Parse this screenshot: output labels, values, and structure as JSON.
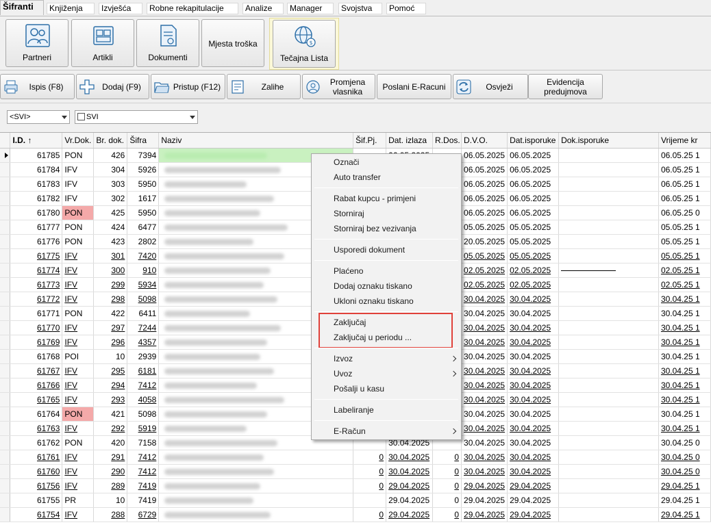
{
  "tabs": [
    {
      "label": "Šifranti",
      "active": true
    },
    {
      "label": "Knjiženja"
    },
    {
      "label": "Izvješća"
    },
    {
      "label": "Robne rekapitulacije"
    },
    {
      "label": "Analize"
    },
    {
      "label": "Manager"
    },
    {
      "label": "Svojstva"
    },
    {
      "label": "Pomoć"
    }
  ],
  "ribbon": {
    "buttons": [
      {
        "label": "Partneri",
        "icon": "partners-icon"
      },
      {
        "label": "Artikli",
        "icon": "articles-icon"
      },
      {
        "label": "Dokumenti",
        "icon": "documents-icon"
      },
      {
        "label": "Mjesta troška"
      },
      {
        "label": "Tečajna Lista",
        "icon": "exchange-rate-icon"
      }
    ]
  },
  "toolbar": {
    "buttons": [
      {
        "label": "Ispis (F8)",
        "icon": "print-icon"
      },
      {
        "label": "Dodaj (F9)",
        "icon": "add-icon"
      },
      {
        "label": "Pristup (F12)",
        "icon": "folder-icon"
      },
      {
        "label": "Zalihe",
        "icon": "stock-icon"
      },
      {
        "label": "Promjena vlasnika",
        "icon": "owner-change-icon"
      },
      {
        "label": "Poslani E-Racuni"
      },
      {
        "label": "Osvježi",
        "icon": "refresh-icon"
      },
      {
        "label": "Evidencija predujmova"
      }
    ]
  },
  "filters": {
    "filter1": "<SVI>",
    "filter2": "SVI"
  },
  "grid": {
    "columns": [
      "I.D. ↑",
      "Vr.Dok.",
      "Br. dok.",
      "Šifra",
      "Naziv",
      "Šif.Pj.",
      "Dat. izlaza",
      "R.Dos.",
      "D.V.O.",
      "Dat.isporuke",
      "Dok.isporuke",
      "Vrijeme kr"
    ],
    "rows": [
      {
        "id": "61785",
        "vr": "PON",
        "br": "426",
        "sifra": "7394",
        "sifpj": "",
        "datiz": "06.05.2025",
        "rdos": "",
        "dvo": "06.05.2025",
        "datisp": "06.05.2025",
        "vrijeme": "06.05.25 1",
        "u": false,
        "current": true,
        "green": true
      },
      {
        "id": "61784",
        "vr": "IFV",
        "br": "304",
        "sifra": "5926",
        "sifpj": "",
        "datiz": "",
        "rdos": "",
        "dvo": "06.05.2025",
        "datisp": "06.05.2025",
        "vrijeme": "06.05.25 1",
        "u": false
      },
      {
        "id": "61783",
        "vr": "IFV",
        "br": "303",
        "sifra": "5950",
        "sifpj": "",
        "datiz": "",
        "rdos": "",
        "dvo": "06.05.2025",
        "datisp": "06.05.2025",
        "vrijeme": "06.05.25 1",
        "u": false
      },
      {
        "id": "61782",
        "vr": "IFV",
        "br": "302",
        "sifra": "1617",
        "sifpj": "",
        "datiz": "",
        "rdos": "",
        "dvo": "06.05.2025",
        "datisp": "06.05.2025",
        "vrijeme": "06.05.25 1",
        "u": false
      },
      {
        "id": "61780",
        "vr": "PON",
        "br": "425",
        "sifra": "5950",
        "sifpj": "",
        "datiz": "",
        "rdos": "",
        "dvo": "06.05.2025",
        "datisp": "06.05.2025",
        "vrijeme": "06.05.25 0",
        "u": false,
        "red": true
      },
      {
        "id": "61777",
        "vr": "PON",
        "br": "424",
        "sifra": "6477",
        "sifpj": "",
        "datiz": "",
        "rdos": "",
        "dvo": "05.05.2025",
        "datisp": "05.05.2025",
        "vrijeme": "05.05.25 1",
        "u": false
      },
      {
        "id": "61776",
        "vr": "PON",
        "br": "423",
        "sifra": "2802",
        "sifpj": "",
        "datiz": "",
        "rdos": "",
        "dvo": "20.05.2025",
        "datisp": "05.05.2025",
        "vrijeme": "05.05.25 1",
        "u": false
      },
      {
        "id": "61775",
        "vr": "IFV",
        "br": "301",
        "sifra": "7420",
        "sifpj": "",
        "datiz": "",
        "rdos": "",
        "dvo": "05.05.2025",
        "datisp": "05.05.2025",
        "vrijeme": "05.05.25 1",
        "u": true
      },
      {
        "id": "61774",
        "vr": "IFV",
        "br": "300",
        "sifra": "910",
        "sifpj": "",
        "datiz": "",
        "rdos": "",
        "dvo": "02.05.2025",
        "datisp": "02.05.2025",
        "vrijeme": "02.05.25 1",
        "u": true,
        "dokline": true
      },
      {
        "id": "61773",
        "vr": "IFV",
        "br": "299",
        "sifra": "5934",
        "sifpj": "",
        "datiz": "",
        "rdos": "",
        "dvo": "02.05.2025",
        "datisp": "02.05.2025",
        "vrijeme": "02.05.25 1",
        "u": true
      },
      {
        "id": "61772",
        "vr": "IFV",
        "br": "298",
        "sifra": "5098",
        "sifpj": "",
        "datiz": "",
        "rdos": "",
        "dvo": "30.04.2025",
        "datisp": "30.04.2025",
        "vrijeme": "30.04.25 1",
        "u": true
      },
      {
        "id": "61771",
        "vr": "PON",
        "br": "422",
        "sifra": "6411",
        "sifpj": "",
        "datiz": "",
        "rdos": "",
        "dvo": "30.04.2025",
        "datisp": "30.04.2025",
        "vrijeme": "30.04.25 1",
        "u": false
      },
      {
        "id": "61770",
        "vr": "IFV",
        "br": "297",
        "sifra": "7244",
        "sifpj": "",
        "datiz": "",
        "rdos": "",
        "dvo": "30.04.2025",
        "datisp": "30.04.2025",
        "vrijeme": "30.04.25 1",
        "u": true
      },
      {
        "id": "61769",
        "vr": "IFV",
        "br": "296",
        "sifra": "4357",
        "sifpj": "",
        "datiz": "",
        "rdos": "",
        "dvo": "30.04.2025",
        "datisp": "30.04.2025",
        "vrijeme": "30.04.25 1",
        "u": true
      },
      {
        "id": "61768",
        "vr": "POI",
        "br": "10",
        "sifra": "2939",
        "sifpj": "",
        "datiz": "",
        "rdos": "",
        "dvo": "30.04.2025",
        "datisp": "30.04.2025",
        "vrijeme": "30.04.25 1",
        "u": false
      },
      {
        "id": "61767",
        "vr": "IFV",
        "br": "295",
        "sifra": "6181",
        "sifpj": "",
        "datiz": "",
        "rdos": "",
        "dvo": "30.04.2025",
        "datisp": "30.04.2025",
        "vrijeme": "30.04.25 1",
        "u": true
      },
      {
        "id": "61766",
        "vr": "IFV",
        "br": "294",
        "sifra": "7412",
        "sifpj": "",
        "datiz": "",
        "rdos": "",
        "dvo": "30.04.2025",
        "datisp": "30.04.2025",
        "vrijeme": "30.04.25 1",
        "u": true
      },
      {
        "id": "61765",
        "vr": "IFV",
        "br": "293",
        "sifra": "4058",
        "sifpj": "",
        "datiz": "",
        "rdos": "",
        "dvo": "30.04.2025",
        "datisp": "30.04.2025",
        "vrijeme": "30.04.25 1",
        "u": true
      },
      {
        "id": "61764",
        "vr": "PON",
        "br": "421",
        "sifra": "5098",
        "sifpj": "",
        "datiz": "",
        "rdos": "",
        "dvo": "30.04.2025",
        "datisp": "30.04.2025",
        "vrijeme": "30.04.25 1",
        "u": false,
        "red": true
      },
      {
        "id": "61763",
        "vr": "IFV",
        "br": "292",
        "sifra": "5919",
        "sifpj": "",
        "datiz": "",
        "rdos": "",
        "dvo": "30.04.2025",
        "datisp": "30.04.2025",
        "vrijeme": "30.04.25 1",
        "u": true
      },
      {
        "id": "61762",
        "vr": "PON",
        "br": "420",
        "sifra": "7158",
        "sifpj": "",
        "datiz": "30.04.2025",
        "rdos": "",
        "dvo": "30.04.2025",
        "datisp": "30.04.2025",
        "vrijeme": "30.04.25 0",
        "u": false
      },
      {
        "id": "61761",
        "vr": "IFV",
        "br": "291",
        "sifra": "7412",
        "sifpj": "0",
        "datiz": "30.04.2025",
        "rdos": "0",
        "dvo": "30.04.2025",
        "datisp": "30.04.2025",
        "vrijeme": "30.04.25 0",
        "u": true
      },
      {
        "id": "61760",
        "vr": "IFV",
        "br": "290",
        "sifra": "7412",
        "sifpj": "0",
        "datiz": "30.04.2025",
        "rdos": "0",
        "dvo": "30.04.2025",
        "datisp": "30.04.2025",
        "vrijeme": "30.04.25 0",
        "u": true
      },
      {
        "id": "61756",
        "vr": "IFV",
        "br": "289",
        "sifra": "7419",
        "sifpj": "0",
        "datiz": "29.04.2025",
        "rdos": "0",
        "dvo": "29.04.2025",
        "datisp": "29.04.2025",
        "vrijeme": "29.04.25 1",
        "u": true
      },
      {
        "id": "61755",
        "vr": "PR",
        "br": "10",
        "sifra": "7419",
        "sifpj": "",
        "datiz": "29.04.2025",
        "rdos": "0",
        "dvo": "29.04.2025",
        "datisp": "29.04.2025",
        "vrijeme": "29.04.25 1",
        "u": false
      },
      {
        "id": "61754",
        "vr": "IFV",
        "br": "288",
        "sifra": "6729",
        "sifpj": "0",
        "datiz": "29.04.2025",
        "rdos": "0",
        "dvo": "29.04.2025",
        "datisp": "29.04.2025",
        "vrijeme": "29.04.25 1",
        "u": true
      }
    ]
  },
  "context_menu": {
    "groups": [
      [
        "Označi",
        "Auto transfer"
      ],
      [
        "Rabat kupcu - primjeni",
        "Storniraj",
        "Storniraj bez vezivanja"
      ],
      [
        "Usporedi dokument"
      ],
      [
        "Plaćeno",
        "Dodaj oznaku tiskano",
        "Ukloni oznaku tiskano"
      ],
      [
        "Zaključaj",
        "Zaključaj u periodu ..."
      ],
      [
        "Izvoz",
        "Uvoz",
        "Pošalji u kasu"
      ],
      [
        "Labeliranje"
      ],
      [
        "E-Račun"
      ]
    ],
    "submenu_items": [
      "Izvoz",
      "Uvoz",
      "E-Račun"
    ],
    "highlight_color": "#e0413a"
  },
  "colors": {
    "accent_red_cell": "#f4a9a9",
    "accent_green_cell": "#a8e8a0",
    "ribbon_group_bg": "#fbf8d8"
  }
}
